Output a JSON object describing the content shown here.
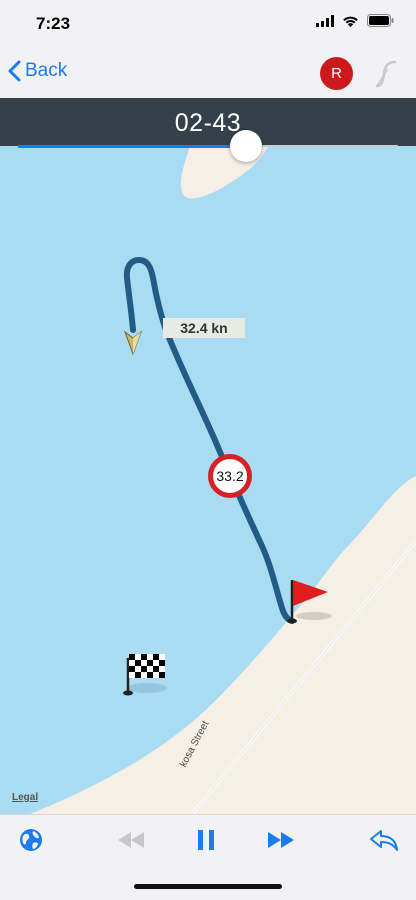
{
  "status_bar": {
    "time": "7:23"
  },
  "nav": {
    "back_label": "Back",
    "record_label": "R"
  },
  "title": {
    "text": "02-43"
  },
  "playback": {
    "progress": 0.6
  },
  "map": {
    "speed_label": "32.4 kn",
    "speed_sign": "33.2",
    "legal_label": "Legal",
    "street_label": "kosa Street"
  },
  "colors": {
    "accent": "#1a7cf0",
    "title_bar": "#35414a",
    "water": "#a9dbf2",
    "land": "#f5efe6",
    "track": "#225b86",
    "record": "#cc1a1a"
  },
  "toolbar": {
    "icons": [
      "globe-icon",
      "rewind-icon",
      "pause-icon",
      "fast-forward-icon",
      "reply-icon"
    ]
  }
}
